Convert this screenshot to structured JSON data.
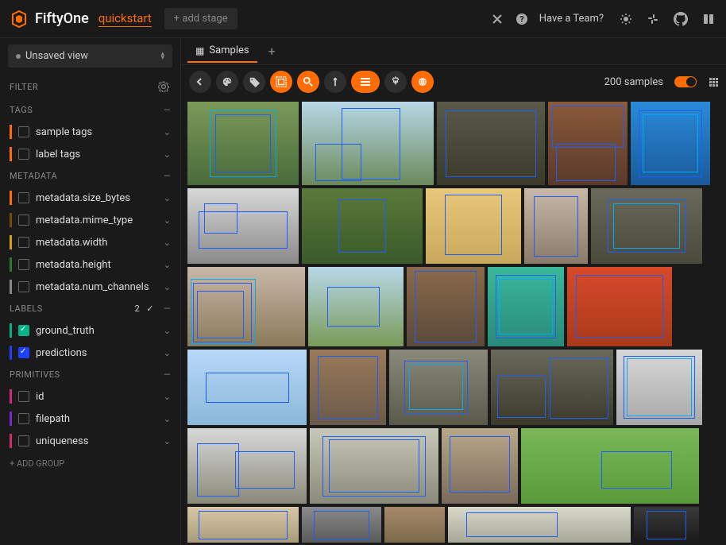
{
  "header": {
    "app_name": "FiftyOne",
    "dataset": "quickstart",
    "add_stage": "+ add stage",
    "have_team": "Have a Team?"
  },
  "sidebar": {
    "view": "Unsaved view",
    "filter_title": "FILTER",
    "sections": {
      "tags": {
        "title": "TAGS",
        "items": [
          {
            "label": "sample tags",
            "color": "#ff6d04"
          },
          {
            "label": "label tags",
            "color": "#ff6d04"
          }
        ]
      },
      "metadata": {
        "title": "METADATA",
        "items": [
          {
            "label": "metadata.size_bytes",
            "color": "#ff6d04"
          },
          {
            "label": "metadata.mime_type",
            "color": "#7a4a00"
          },
          {
            "label": "metadata.width",
            "color": "#d4a017"
          },
          {
            "label": "metadata.height",
            "color": "#2a7a2a"
          },
          {
            "label": "metadata.num_channels",
            "color": "#888"
          }
        ]
      },
      "labels": {
        "title": "LABELS",
        "count": "2",
        "items": [
          {
            "label": "ground_truth",
            "color": "#05b18a",
            "checked": true
          },
          {
            "label": "predictions",
            "color": "#1e40ff",
            "checked": true
          }
        ]
      },
      "primitives": {
        "title": "PRIMITIVES",
        "items": [
          {
            "label": "id",
            "color": "#d4267a"
          },
          {
            "label": "filepath",
            "color": "#7a26d4"
          },
          {
            "label": "uniqueness",
            "color": "#d42a6a"
          }
        ]
      }
    },
    "add_group": "+ ADD GROUP"
  },
  "content": {
    "tab_label": "Samples",
    "sample_count": "200 samples"
  }
}
